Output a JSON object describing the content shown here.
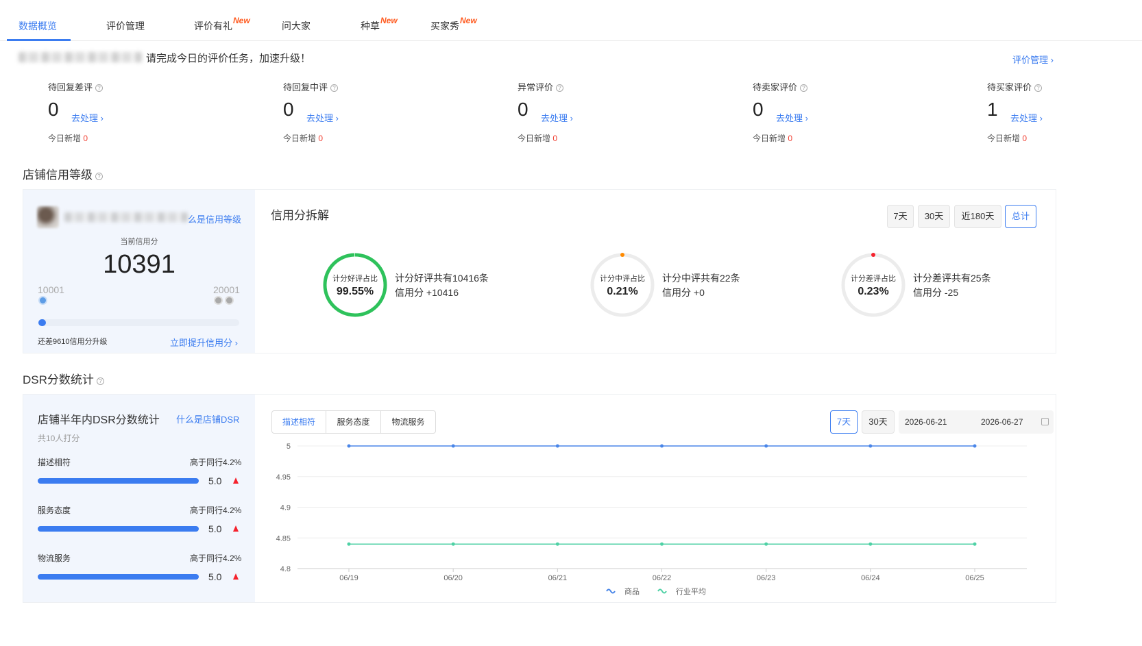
{
  "tabs": [
    {
      "label": "数据概览",
      "active": true,
      "new": ""
    },
    {
      "label": "评价管理",
      "active": false,
      "new": ""
    },
    {
      "label": "评价有礼",
      "active": false,
      "new": "New"
    },
    {
      "label": "问大家",
      "active": false,
      "new": ""
    },
    {
      "label": "种草",
      "active": false,
      "new": "New"
    },
    {
      "label": "买家秀",
      "active": false,
      "new": "New"
    }
  ],
  "task": {
    "message": "请完成今日的评价任务，加速升级！",
    "manage_link": "评价管理 ›"
  },
  "stats": [
    {
      "label": "待回复差评",
      "value": "0",
      "action": "去处理 ›",
      "today_label": "今日新增",
      "today_value": "0"
    },
    {
      "label": "待回复中评",
      "value": "0",
      "action": "去处理 ›",
      "today_label": "今日新增",
      "today_value": "0"
    },
    {
      "label": "异常评价",
      "value": "0",
      "action": "去处理 ›",
      "today_label": "今日新增",
      "today_value": "0"
    },
    {
      "label": "待卖家评价",
      "value": "0",
      "action": "去处理 ›",
      "today_label": "今日新增",
      "today_value": "0"
    },
    {
      "label": "待买家评价",
      "value": "1",
      "action": "去处理 ›",
      "today_label": "今日新增",
      "today_value": "0"
    }
  ],
  "credit": {
    "section_title": "店铺信用等级",
    "what_link": "么是信用等级",
    "score_label": "当前信用分",
    "score": "10391",
    "min": "10001",
    "max": "20001",
    "progress": 0.039,
    "remain": "还差9610信用分升级",
    "boost_link": "立即提升信用分 ›"
  },
  "breakdown": {
    "title": "信用分拆解",
    "ranges": [
      "7天",
      "30天",
      "近180天",
      "总计"
    ],
    "selected_range": "总计",
    "items": [
      {
        "ring_label": "计分好评占比",
        "percent": "99.55%",
        "fraction": 0.9955,
        "line1": "计分好评共有10416条",
        "line2": "信用分 +10416",
        "color": "#2ec25b"
      },
      {
        "ring_label": "计分中评占比",
        "percent": "0.21%",
        "fraction": 0.0021,
        "line1": "计分中评共有22条",
        "line2": "信用分 +0",
        "color": "#ff8a00"
      },
      {
        "ring_label": "计分差评占比",
        "percent": "0.23%",
        "fraction": 0.0023,
        "line1": "计分差评共有25条",
        "line2": "信用分 -25",
        "color": "#f5222d"
      }
    ]
  },
  "dsr": {
    "section_title": "DSR分数统计",
    "panel_title": "店铺半年内DSR分数统计",
    "what_link": "什么是店铺DSR",
    "count": "共10人打分",
    "metrics": [
      {
        "name": "描述相符",
        "compare": "高于同行4.2%",
        "score": "5.0",
        "fraction": 1.0
      },
      {
        "name": "服务态度",
        "compare": "高于同行4.2%",
        "score": "5.0",
        "fraction": 1.0
      },
      {
        "name": "物流服务",
        "compare": "高于同行4.2%",
        "score": "5.0",
        "fraction": 1.0
      }
    ],
    "chart_tabs": [
      "描述相符",
      "服务态度",
      "物流服务"
    ],
    "selected_tab": "描述相符",
    "ranges": [
      "7天",
      "30天"
    ],
    "selected_range": "7天",
    "date_start": "2026-06-21",
    "date_end": "2026-06-27"
  },
  "chart_data": {
    "type": "line",
    "x": [
      "06/19",
      "06/20",
      "06/21",
      "06/22",
      "06/23",
      "06/24",
      "06/25"
    ],
    "series": [
      {
        "name": "商品",
        "values": [
          5,
          5,
          5,
          5,
          5,
          5,
          5
        ],
        "color": "#4a86e8"
      },
      {
        "name": "行业平均",
        "values": [
          4.84,
          4.84,
          4.84,
          4.84,
          4.84,
          4.84,
          4.84
        ],
        "color": "#4fd1a5"
      }
    ],
    "yticks": [
      "5",
      "4.95",
      "4.9",
      "4.85",
      "4.8"
    ],
    "ylim": [
      4.8,
      5
    ],
    "grid": true,
    "legend": "bottom-center"
  }
}
